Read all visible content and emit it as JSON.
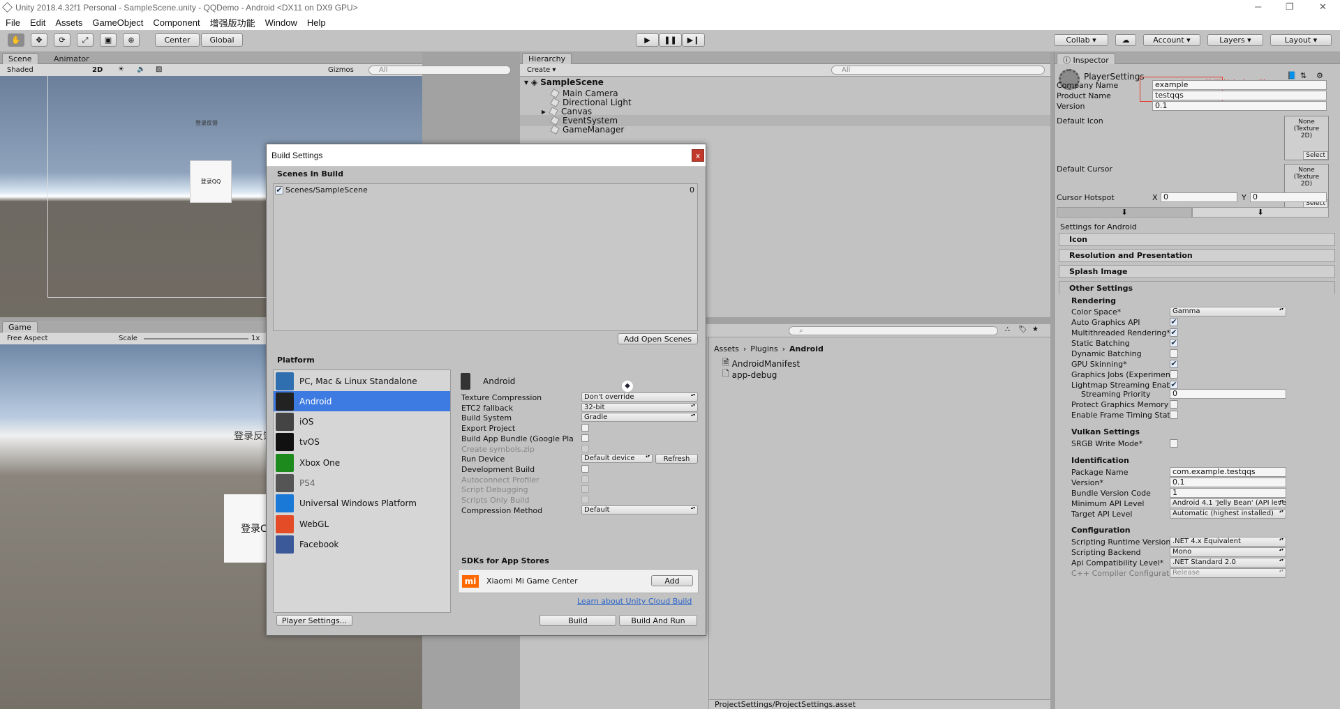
{
  "window": {
    "title": "Unity 2018.4.32f1 Personal - SampleScene.unity - QQDemo - Android <DX11 on DX9 GPU>"
  },
  "menu": [
    "File",
    "Edit",
    "Assets",
    "GameObject",
    "Component",
    "增强版功能",
    "Window",
    "Help"
  ],
  "toolbar": {
    "pivot": "Center",
    "space": "Global",
    "collab": "Collab",
    "account": "Account",
    "layers": "Layers",
    "layout": "Layout"
  },
  "scene": {
    "tab": "Scene",
    "tab2": "Animator",
    "shading": "Shaded",
    "mode2d": "2D",
    "gizmos": "Gizmos",
    "search_placeholder": "All",
    "label_top": "登录反馈",
    "button_label": "登录QQ"
  },
  "game": {
    "tab": "Game",
    "aspect": "Free Aspect",
    "scale_label": "Scale",
    "scale_value": "1x",
    "text_partial": "登录反馈",
    "button_partial": "登录C"
  },
  "hierarchy": {
    "tab": "Hierarchy",
    "create": "Create",
    "search_placeholder": "All",
    "scene": "SampleScene",
    "items": [
      "Main Camera",
      "Directional Light",
      "Canvas",
      "EventSystem",
      "GameManager"
    ]
  },
  "project": {
    "breadcrumb": [
      "Assets",
      "Plugins",
      "Android"
    ],
    "files": [
      "AndroidManifest",
      "app-debug"
    ],
    "status_path": "ProjectSettings/ProjectSettings.asset"
  },
  "inspector": {
    "tab": "Inspector",
    "asset": "PlayerSettings",
    "annotation": "与aar外面的包名一致",
    "company_label": "Company Name",
    "company": "example",
    "product_label": "Product Name",
    "product": "testqqs",
    "version_label": "Version",
    "version": "0.1",
    "default_icon_label": "Default Icon",
    "default_cursor_label": "Default Cursor",
    "none_texture": "None (Texture 2D)",
    "select": "Select",
    "hotspot_label": "Cursor Hotspot",
    "hx": "X",
    "hx_val": "0",
    "hy": "Y",
    "hy_val": "0",
    "settings_for": "Settings for Android",
    "headers": [
      "Icon",
      "Resolution and Presentation",
      "Splash Image"
    ],
    "other": "Other Settings",
    "rendering": "Rendering",
    "color_space_label": "Color Space*",
    "color_space": "Gamma",
    "rows": [
      {
        "label": "Auto Graphics API",
        "checked": true
      },
      {
        "label": "Multithreaded Rendering*",
        "checked": true
      },
      {
        "label": "Static Batching",
        "checked": true
      },
      {
        "label": "Dynamic Batching",
        "checked": false
      },
      {
        "label": "GPU Skinning*",
        "checked": true
      },
      {
        "label": "Graphics Jobs (Experimen",
        "checked": false
      },
      {
        "label": "Lightmap Streaming Enab",
        "checked": true
      }
    ],
    "streaming_priority_label": "Streaming Priority",
    "streaming_priority": "0",
    "protect_label": "Protect Graphics Memory",
    "frame_timing_label": "Enable Frame Timing Stat",
    "vulkan": "Vulkan Settings",
    "srgb_label": "SRGB Write Mode*",
    "identification": "Identification",
    "package_label": "Package Name",
    "package": "com.example.testqqs",
    "version2_label": "Version*",
    "version2": "0.1",
    "bundle_label": "Bundle Version Code",
    "bundle": "1",
    "min_api_label": "Minimum API Level",
    "min_api": "Android 4.1 'Jelly Bean' (API level 16",
    "target_api_label": "Target API Level",
    "target_api": "Automatic (highest installed)",
    "configuration": "Configuration",
    "runtime_label": "Scripting Runtime Version",
    "runtime": ".NET 4.x Equivalent",
    "backend_label": "Scripting Backend",
    "backend": "Mono",
    "compat_label": "Api Compatibility Level*",
    "compat": ".NET Standard 2.0",
    "cpp_label": "C++ Compiler Configurat",
    "cpp": "Release"
  },
  "build": {
    "title": "Build Settings",
    "close": "x",
    "scenes_header": "Scenes In Build",
    "scene_item": "Scenes/SampleScene",
    "scene_index": "0",
    "add_open_scenes": "Add Open Scenes",
    "platform_header": "Platform",
    "platforms": [
      {
        "name": "PC, Mac & Linux Standalone",
        "icon": "pc-icon",
        "color": "#2f6fb0"
      },
      {
        "name": "Android",
        "icon": "android-icon",
        "color": "#222"
      },
      {
        "name": "iOS",
        "icon": "ios-icon",
        "color": "#444"
      },
      {
        "name": "tvOS",
        "icon": "tvos-icon",
        "color": "#111"
      },
      {
        "name": "Xbox One",
        "icon": "xbox-icon",
        "color": "#1d8a1d"
      },
      {
        "name": "PS4",
        "icon": "ps4-icon",
        "color": "#555"
      },
      {
        "name": "Universal Windows Platform",
        "icon": "windows-icon",
        "color": "#1a78d6"
      },
      {
        "name": "WebGL",
        "icon": "html5-icon",
        "color": "#e34c26"
      },
      {
        "name": "Facebook",
        "icon": "facebook-icon",
        "color": "#3b5998"
      }
    ],
    "selected_platform": "Android",
    "options": [
      {
        "label": "Texture Compression",
        "value": "Don't override",
        "kind": "drop"
      },
      {
        "label": "ETC2 fallback",
        "value": "32-bit",
        "kind": "drop"
      },
      {
        "label": "Build System",
        "value": "Gradle",
        "kind": "drop"
      },
      {
        "label": "Export Project",
        "kind": "chk"
      },
      {
        "label": "Build App Bundle (Google Pla",
        "kind": "chk"
      },
      {
        "label": "Create symbols.zip",
        "kind": "chk",
        "disabled": true
      },
      {
        "label": "Run Device",
        "value": "Default device",
        "kind": "run"
      },
      {
        "label": "Development Build",
        "kind": "chk"
      },
      {
        "label": "Autoconnect Profiler",
        "kind": "chk",
        "disabled": true
      },
      {
        "label": "Script Debugging",
        "kind": "chk",
        "disabled": true
      },
      {
        "label": "Scripts Only Build",
        "kind": "chk",
        "disabled": true
      },
      {
        "label": "Compression Method",
        "value": "Default",
        "kind": "drop"
      }
    ],
    "refresh": "Refresh",
    "sdk_header": "SDKs for App Stores",
    "sdk_name": "Xiaomi Mi Game Center",
    "sdk_add": "Add",
    "cloud_link": "Learn about Unity Cloud Build",
    "player_settings": "Player Settings...",
    "build_btn": "Build",
    "build_run": "Build And Run"
  },
  "colors": {
    "selection": "#3d7be3",
    "annotation": "#e23b2b",
    "link": "#2a64c9"
  }
}
